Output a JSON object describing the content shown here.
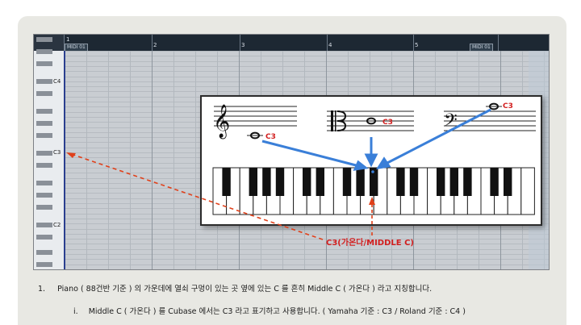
{
  "editor": {
    "part_start_label": "MIDI 01",
    "part_end_label": "MIDI 01",
    "bar_numbers": [
      "1",
      "2",
      "3",
      "4",
      "5"
    ],
    "key_labels": [
      "C4",
      "C3",
      "C2"
    ]
  },
  "popup": {
    "treble_note_label": "C3",
    "alto_note_label": "C3",
    "bass_note_label": "C3"
  },
  "annotation": {
    "label": "C3(가온다/MIDDLE C)"
  },
  "text": {
    "line1_num": "1.",
    "line1": "Piano ( 88건반 기준 ) 의 가운데에 열쇠 구멍이 있는 곳 옆에 있는 C 를 흔히 Middle C ( 가온다 ) 라고 지칭합니다.",
    "line2_num": "i.",
    "line2": "Middle C ( 가온다 ) 를 Cubase 에서는 C3 라고 표기하고 사용합니다. ( Yamaha 기준 : C3 / Roland 기준 : C4 )"
  },
  "colors": {
    "accent_red": "#d21f1f",
    "arrow_blue": "#3a7fd8",
    "ruler_dark": "#1d2833",
    "grid_bg": "#c9cdd2"
  },
  "icons": [
    "treble-clef-icon",
    "alto-clef-icon",
    "bass-clef-icon",
    "keyhole-icon",
    "whole-note-icon"
  ]
}
